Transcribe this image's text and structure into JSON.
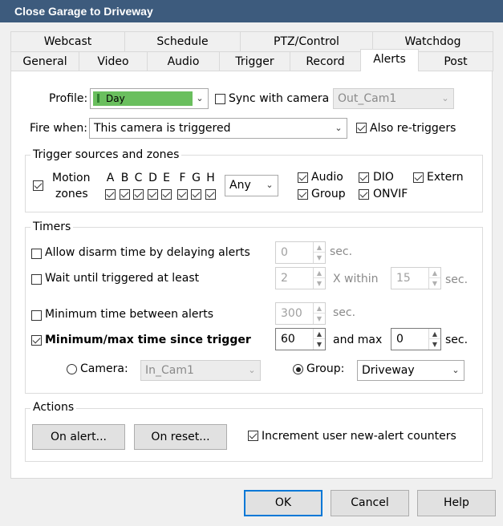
{
  "window": {
    "title": "Close Garage to Driveway"
  },
  "tabs_top": [
    "Webcast",
    "Schedule",
    "PTZ/Control",
    "Watchdog"
  ],
  "tabs_bottom": [
    "General",
    "Video",
    "Audio",
    "Trigger",
    "Record",
    "Alerts",
    "Post"
  ],
  "active_tab": "Alerts",
  "profile": {
    "label": "Profile:",
    "value": "Day",
    "icon": "profile-bar-icon",
    "color": "#6abf5e",
    "sync_label": "Sync with camera",
    "sync_checked": false,
    "sync_camera": "Out_Cam1"
  },
  "fire_when": {
    "label": "Fire when:",
    "value": "This camera is triggered",
    "also_retriggers_label": "Also re-triggers",
    "also_retriggers_checked": true
  },
  "trigger_sources": {
    "title": "Trigger sources and zones",
    "motion_checked": true,
    "motion_label_1": "Motion",
    "motion_label_2": "zones",
    "zones": [
      "A",
      "B",
      "C",
      "D",
      "E",
      "F",
      "G",
      "H"
    ],
    "zones_checked": [
      true,
      true,
      true,
      true,
      true,
      true,
      true,
      true
    ],
    "zone_mode": "Any",
    "sources": [
      {
        "label": "Audio",
        "checked": true
      },
      {
        "label": "DIO",
        "checked": true
      },
      {
        "label": "Extern",
        "checked": true
      },
      {
        "label": "Group",
        "checked": true
      },
      {
        "label": "ONVIF",
        "checked": true
      }
    ]
  },
  "timers": {
    "title": "Timers",
    "disarm": {
      "label": "Allow disarm time by delaying alerts",
      "checked": false,
      "value": "0",
      "unit": "sec."
    },
    "wait": {
      "label": "Wait until triggered at least",
      "checked": false,
      "value": "2",
      "x_within": "X within",
      "within_value": "15",
      "unit": "sec."
    },
    "min_between": {
      "label": "Minimum time between alerts",
      "checked": false,
      "value": "300",
      "unit": "sec."
    },
    "min_max": {
      "label": "Minimum/max time since trigger",
      "checked": true,
      "value": "60",
      "and_max": "and max",
      "max_value": "0",
      "unit": "sec."
    },
    "camera_radio": {
      "label": "Camera:",
      "checked": false,
      "value": "In_Cam1"
    },
    "group_radio": {
      "label": "Group:",
      "checked": true,
      "value": "Driveway"
    }
  },
  "actions": {
    "title": "Actions",
    "on_alert": "On alert...",
    "on_reset": "On reset...",
    "increment_label": "Increment user new-alert counters",
    "increment_checked": true
  },
  "footer": {
    "ok": "OK",
    "cancel": "Cancel",
    "help": "Help"
  }
}
